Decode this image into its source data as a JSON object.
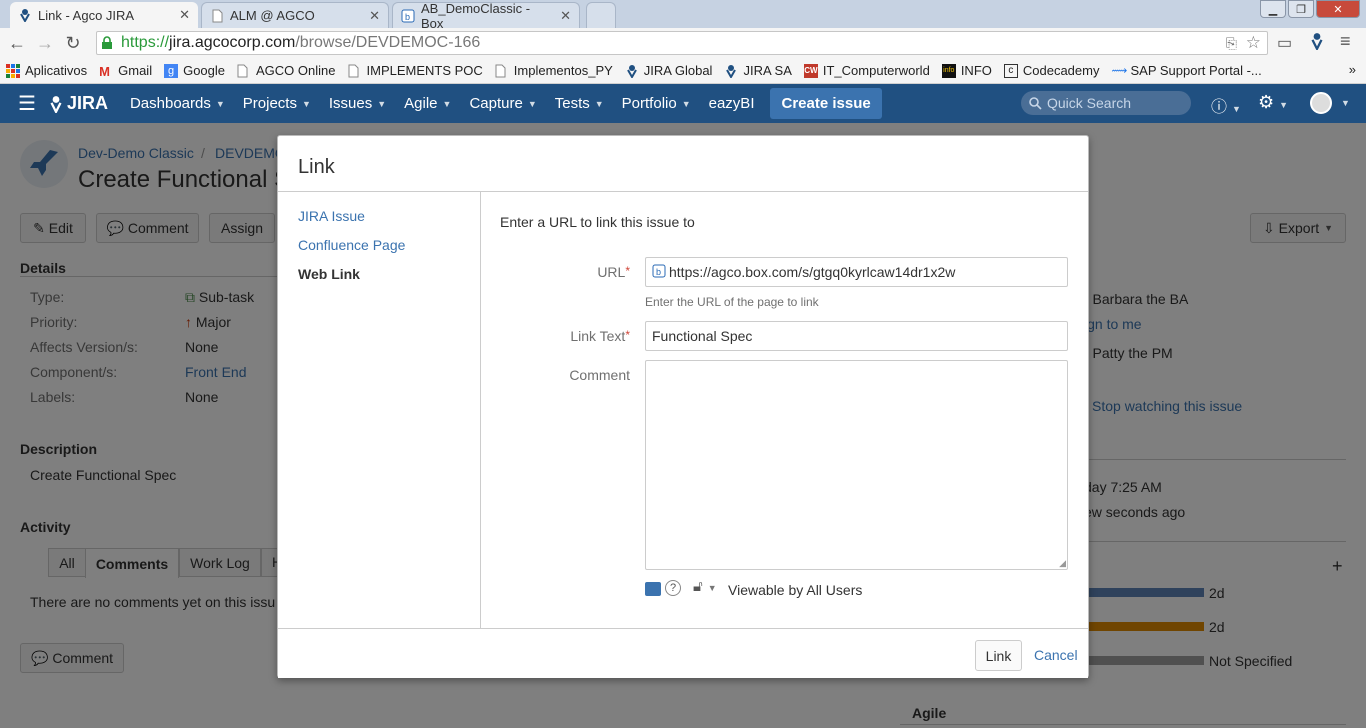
{
  "browser": {
    "tabs": [
      {
        "title": "Link - Agco JIRA",
        "active": true
      },
      {
        "title": "ALM @ AGCO",
        "active": false
      },
      {
        "title": "AB_DemoClassic - Box",
        "active": false
      }
    ],
    "url_prefix": "https://",
    "url_host": "jira.agcocorp.com",
    "url_path": "/browse/DEVDEMOC-166",
    "bookmarks": [
      {
        "label": "Aplicativos",
        "icon": "apps-grid-icon"
      },
      {
        "label": "Gmail",
        "icon": "gmail-icon"
      },
      {
        "label": "Google",
        "icon": "google-icon"
      },
      {
        "label": "AGCO Online",
        "icon": "page-icon"
      },
      {
        "label": "IMPLEMENTS POC",
        "icon": "page-icon"
      },
      {
        "label": "Implementos_PY",
        "icon": "page-icon"
      },
      {
        "label": "JIRA Global",
        "icon": "jira-icon"
      },
      {
        "label": "JIRA SA",
        "icon": "jira-icon"
      },
      {
        "label": "IT_Computerworld",
        "icon": "cw-icon"
      },
      {
        "label": "INFO",
        "icon": "info-icon"
      },
      {
        "label": "Codecademy",
        "icon": "codecademy-icon"
      },
      {
        "label": "SAP Support Portal -...",
        "icon": "sap-icon"
      }
    ],
    "bookmarks_overflow": "»"
  },
  "jira": {
    "logo": "JIRA",
    "nav": [
      "Dashboards",
      "Projects",
      "Issues",
      "Agile",
      "Capture",
      "Tests",
      "Portfolio",
      "eazyBI"
    ],
    "create_label": "Create issue",
    "search_placeholder": "Quick Search"
  },
  "issue": {
    "project": "Dev-Demo Classic",
    "breadcrumb_sep": "/",
    "issue_key_partial": "DEVDEMOC",
    "title_partial": "Create Functional S",
    "actions": {
      "edit": "Edit",
      "comment": "Comment",
      "assign": "Assign",
      "export": "Export"
    },
    "details_heading": "Details",
    "details": [
      {
        "label": "Type:",
        "value": "Sub-task",
        "link": false,
        "icon": "subtask-icon"
      },
      {
        "label": "Priority:",
        "value": "Major",
        "link": false,
        "icon": "priority-major-icon"
      },
      {
        "label": "Affects Version/s:",
        "value": "None",
        "link": false,
        "icon": ""
      },
      {
        "label": "Component/s:",
        "value": "Front End",
        "link": true,
        "icon": ""
      },
      {
        "label": "Labels:",
        "value": "None",
        "link": false,
        "icon": ""
      }
    ],
    "description_heading": "Description",
    "description": "Create Functional Spec",
    "activity_heading": "Activity",
    "activity_tabs": [
      "All",
      "Comments",
      "Work Log",
      "H"
    ],
    "activity_active_tab": "Comments",
    "no_comments": "There are no comments yet on this issu",
    "comment_button": "Comment",
    "people": {
      "assignee": ") Barbara the BA",
      "assign_to_me": "ign to me",
      "reporter": ") Patty the PM",
      "stop_watching": "Stop watching this issue"
    },
    "dates": {
      "created": "day 7:25 AM",
      "updated": "ew seconds ago"
    },
    "time_tracking": [
      {
        "value": "2d",
        "color": "#5e84b9"
      },
      {
        "value": "2d",
        "color": "#e08b00"
      },
      {
        "value": "Not Specified",
        "color": "#a0a0a0"
      }
    ],
    "agile_heading": "Agile"
  },
  "dialog": {
    "title": "Link",
    "menu": [
      {
        "label": "JIRA Issue",
        "selected": false
      },
      {
        "label": "Confluence Page",
        "selected": false
      },
      {
        "label": "Web Link",
        "selected": true
      }
    ],
    "intro": "Enter a URL to link this issue to",
    "url_label": "URL",
    "url_value": "https://agco.box.com/s/gtgq0kyrlcaw14dr1x2w",
    "url_help": "Enter the URL of the page to link",
    "link_text_label": "Link Text",
    "link_text_value": "Functional Spec",
    "comment_label": "Comment",
    "comment_value": "",
    "visibility": "Viewable by All Users",
    "required_mark": "*",
    "submit_label": "Link",
    "cancel_label": "Cancel"
  }
}
